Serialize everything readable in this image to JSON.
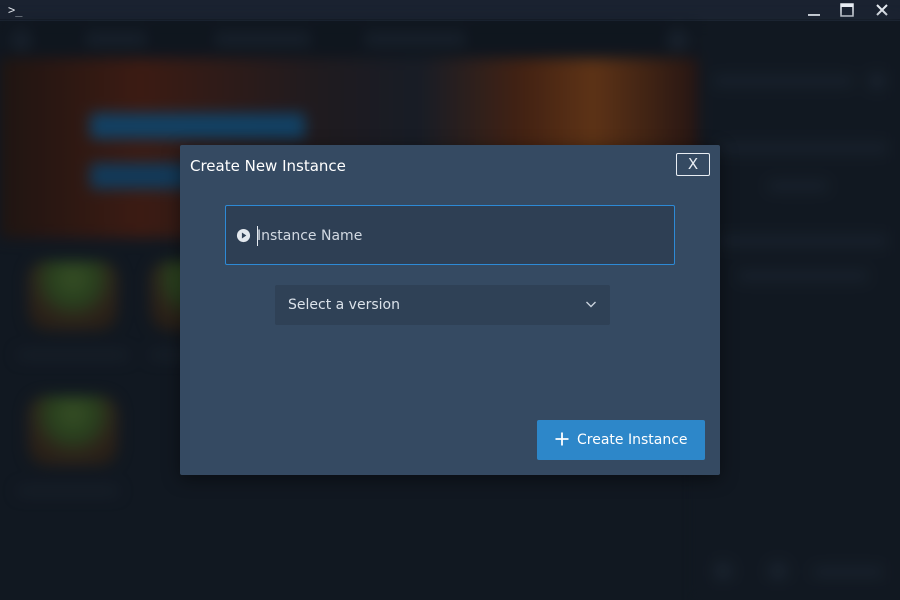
{
  "window": {
    "app_icon": "terminal-icon",
    "controls": [
      "minimize",
      "maximize",
      "close"
    ]
  },
  "dialog": {
    "title": "Create New Instance",
    "close_label": "X",
    "name_input": {
      "placeholder": "Instance Name",
      "value": "",
      "icon": "play-circle-icon"
    },
    "version_select": {
      "selected": "Select a version",
      "icon": "chevron-down-icon"
    },
    "create_button": {
      "label": "Create Instance",
      "icon": "plus-icon"
    }
  },
  "colors": {
    "dialog_bg": "#354a62",
    "accent": "#2d87c9",
    "input_focus_border": "#2d8ad6"
  }
}
